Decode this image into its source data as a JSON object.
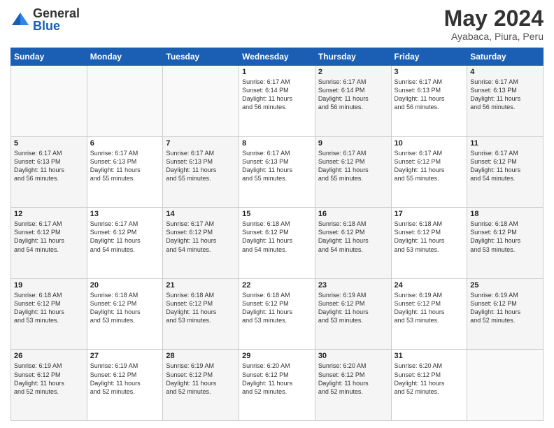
{
  "header": {
    "logo_general": "General",
    "logo_blue": "Blue",
    "month_title": "May 2024",
    "location": "Ayabaca, Piura, Peru"
  },
  "days_of_week": [
    "Sunday",
    "Monday",
    "Tuesday",
    "Wednesday",
    "Thursday",
    "Friday",
    "Saturday"
  ],
  "weeks": [
    [
      {
        "day": "",
        "info": ""
      },
      {
        "day": "",
        "info": ""
      },
      {
        "day": "",
        "info": ""
      },
      {
        "day": "1",
        "info": "Sunrise: 6:17 AM\nSunset: 6:14 PM\nDaylight: 11 hours\nand 56 minutes."
      },
      {
        "day": "2",
        "info": "Sunrise: 6:17 AM\nSunset: 6:14 PM\nDaylight: 11 hours\nand 56 minutes."
      },
      {
        "day": "3",
        "info": "Sunrise: 6:17 AM\nSunset: 6:13 PM\nDaylight: 11 hours\nand 56 minutes."
      },
      {
        "day": "4",
        "info": "Sunrise: 6:17 AM\nSunset: 6:13 PM\nDaylight: 11 hours\nand 56 minutes."
      }
    ],
    [
      {
        "day": "5",
        "info": "Sunrise: 6:17 AM\nSunset: 6:13 PM\nDaylight: 11 hours\nand 56 minutes."
      },
      {
        "day": "6",
        "info": "Sunrise: 6:17 AM\nSunset: 6:13 PM\nDaylight: 11 hours\nand 55 minutes."
      },
      {
        "day": "7",
        "info": "Sunrise: 6:17 AM\nSunset: 6:13 PM\nDaylight: 11 hours\nand 55 minutes."
      },
      {
        "day": "8",
        "info": "Sunrise: 6:17 AM\nSunset: 6:13 PM\nDaylight: 11 hours\nand 55 minutes."
      },
      {
        "day": "9",
        "info": "Sunrise: 6:17 AM\nSunset: 6:12 PM\nDaylight: 11 hours\nand 55 minutes."
      },
      {
        "day": "10",
        "info": "Sunrise: 6:17 AM\nSunset: 6:12 PM\nDaylight: 11 hours\nand 55 minutes."
      },
      {
        "day": "11",
        "info": "Sunrise: 6:17 AM\nSunset: 6:12 PM\nDaylight: 11 hours\nand 54 minutes."
      }
    ],
    [
      {
        "day": "12",
        "info": "Sunrise: 6:17 AM\nSunset: 6:12 PM\nDaylight: 11 hours\nand 54 minutes."
      },
      {
        "day": "13",
        "info": "Sunrise: 6:17 AM\nSunset: 6:12 PM\nDaylight: 11 hours\nand 54 minutes."
      },
      {
        "day": "14",
        "info": "Sunrise: 6:17 AM\nSunset: 6:12 PM\nDaylight: 11 hours\nand 54 minutes."
      },
      {
        "day": "15",
        "info": "Sunrise: 6:18 AM\nSunset: 6:12 PM\nDaylight: 11 hours\nand 54 minutes."
      },
      {
        "day": "16",
        "info": "Sunrise: 6:18 AM\nSunset: 6:12 PM\nDaylight: 11 hours\nand 54 minutes."
      },
      {
        "day": "17",
        "info": "Sunrise: 6:18 AM\nSunset: 6:12 PM\nDaylight: 11 hours\nand 53 minutes."
      },
      {
        "day": "18",
        "info": "Sunrise: 6:18 AM\nSunset: 6:12 PM\nDaylight: 11 hours\nand 53 minutes."
      }
    ],
    [
      {
        "day": "19",
        "info": "Sunrise: 6:18 AM\nSunset: 6:12 PM\nDaylight: 11 hours\nand 53 minutes."
      },
      {
        "day": "20",
        "info": "Sunrise: 6:18 AM\nSunset: 6:12 PM\nDaylight: 11 hours\nand 53 minutes."
      },
      {
        "day": "21",
        "info": "Sunrise: 6:18 AM\nSunset: 6:12 PM\nDaylight: 11 hours\nand 53 minutes."
      },
      {
        "day": "22",
        "info": "Sunrise: 6:18 AM\nSunset: 6:12 PM\nDaylight: 11 hours\nand 53 minutes."
      },
      {
        "day": "23",
        "info": "Sunrise: 6:19 AM\nSunset: 6:12 PM\nDaylight: 11 hours\nand 53 minutes."
      },
      {
        "day": "24",
        "info": "Sunrise: 6:19 AM\nSunset: 6:12 PM\nDaylight: 11 hours\nand 53 minutes."
      },
      {
        "day": "25",
        "info": "Sunrise: 6:19 AM\nSunset: 6:12 PM\nDaylight: 11 hours\nand 52 minutes."
      }
    ],
    [
      {
        "day": "26",
        "info": "Sunrise: 6:19 AM\nSunset: 6:12 PM\nDaylight: 11 hours\nand 52 minutes."
      },
      {
        "day": "27",
        "info": "Sunrise: 6:19 AM\nSunset: 6:12 PM\nDaylight: 11 hours\nand 52 minutes."
      },
      {
        "day": "28",
        "info": "Sunrise: 6:19 AM\nSunset: 6:12 PM\nDaylight: 11 hours\nand 52 minutes."
      },
      {
        "day": "29",
        "info": "Sunrise: 6:20 AM\nSunset: 6:12 PM\nDaylight: 11 hours\nand 52 minutes."
      },
      {
        "day": "30",
        "info": "Sunrise: 6:20 AM\nSunset: 6:12 PM\nDaylight: 11 hours\nand 52 minutes."
      },
      {
        "day": "31",
        "info": "Sunrise: 6:20 AM\nSunset: 6:12 PM\nDaylight: 11 hours\nand 52 minutes."
      },
      {
        "day": "",
        "info": ""
      }
    ]
  ]
}
